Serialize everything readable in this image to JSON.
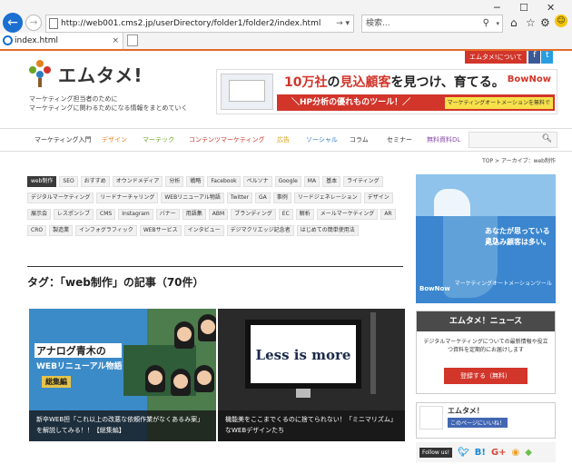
{
  "browser": {
    "url": "http://web001.cms2.jp/userDirectory/folder1/folder2/index.html",
    "search_placeholder": "検索...",
    "tab_title": "index.html",
    "icons": [
      "back-icon",
      "forward-icon",
      "refresh-icon",
      "search-icon",
      "home-icon",
      "favorites-icon",
      "settings-icon",
      "smiley-icon"
    ]
  },
  "topbar": {
    "about_label": "エムタメ!について"
  },
  "site": {
    "logo_text": "エムタメ!",
    "tagline": [
      "マーケティング担当者のために",
      "マーケティングに関わるためになる情報をまとめていく"
    ]
  },
  "banner": {
    "title_pre": "10万社",
    "title_mid": "の",
    "title_hi": "見込顧客",
    "title_post": "を見つけ、育てる。",
    "logo": "BowNow",
    "bar": "＼HP分析の優れものツール！／",
    "sub": "マーケティングオートメーションを無料で"
  },
  "gnav": {
    "items": [
      {
        "label": "マーケティング入門",
        "color": "#333333"
      },
      {
        "label": "デザイン",
        "color": "#e0821f"
      },
      {
        "label": "マーテック",
        "color": "#6aa624"
      },
      {
        "label": "コンテンツマーケティング",
        "color": "#d2352a"
      },
      {
        "label": "広告",
        "color": "#d9a014"
      },
      {
        "label": "ソーシャル",
        "color": "#2c7bc0"
      },
      {
        "label": "コラム",
        "color": "#333333"
      },
      {
        "label": "セミナー",
        "color": "#333333"
      },
      {
        "label": "無料資料DL",
        "color": "#8a4fb0"
      }
    ]
  },
  "breadcrumb": "TOP > アーカイブ：web制作",
  "tags": [
    "web制作",
    "SEO",
    "おすすめ",
    "オウンドメディア",
    "分析",
    "戦略",
    "Facebook",
    "ペルソナ",
    "Google",
    "MA",
    "基本",
    "ライティング",
    "デジタルマーケティング",
    "リードナーチャリング",
    "WEBリニューアル物語",
    "Twitter",
    "GA",
    "事例",
    "リードジェネレーション",
    "デザイン",
    "展示会",
    "レスポンシブ",
    "CMS",
    "Instagram",
    "バナー",
    "用語集",
    "ABM",
    "ブランディング",
    "EC",
    "解析",
    "メールマーケティング",
    "AR",
    "CRO",
    "製造業",
    "インフォグラフィック",
    "WEBサービス",
    "インタビュー",
    "デジマクリエッジ記念者",
    "はじめての簡単使用法"
  ],
  "page_title": "タグ：「web制作」の記事（70件）",
  "cards": [
    {
      "caption": "新卒WEB担「これ以上の改悪な依頼作業がなくあるみ案」を解説してみる！！【総集編】",
      "img_title": "アナログ青木の",
      "img_sub": "WEBリニューアル物語",
      "img_badge": "総集編"
    },
    {
      "caption": "機能美をここまでくるのに捨てられない！「ミニマリズム」なWEBデザインたち",
      "img_title": "Less is more"
    }
  ],
  "sidebar": {
    "ad_line1": "あなたが思っているより",
    "ad_line2": "見込み顧客は多い。",
    "ad_logo": "BowNow",
    "ad_sub": "マーケティングオートメーションツール",
    "news_title": "エムタメ！ニュース",
    "news_text": "デジタルマーケティングについての最新情報や役立つ資料を定期的にお届けします",
    "news_button": "登録する（無料）",
    "fb_name": "エムタメ！",
    "fb_sub": "このページにいいね！",
    "follow_label": "Follow us!",
    "social_icons": [
      "twitter-icon",
      "hatena-icon",
      "googleplus-icon",
      "rss-icon",
      "feedly-icon"
    ]
  }
}
